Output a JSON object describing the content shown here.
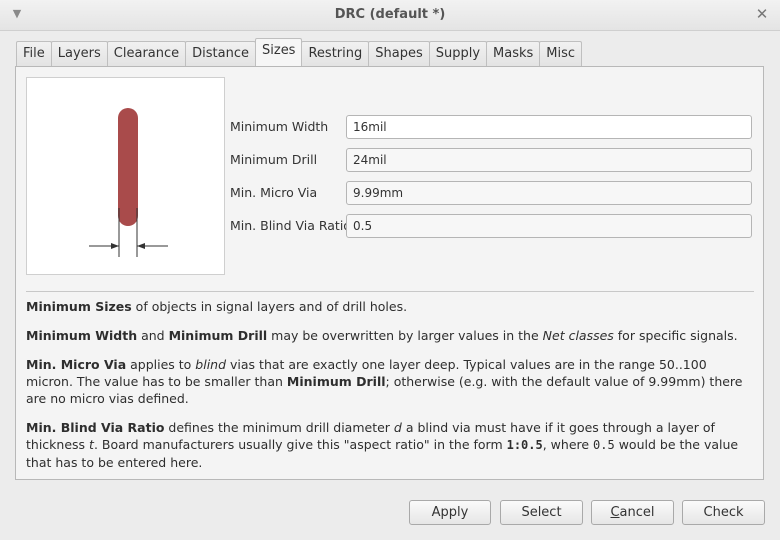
{
  "window": {
    "title": "DRC (default *)"
  },
  "tabs": [
    {
      "label": "File"
    },
    {
      "label": "Layers"
    },
    {
      "label": "Clearance"
    },
    {
      "label": "Distance"
    },
    {
      "label": "Sizes"
    },
    {
      "label": "Restring"
    },
    {
      "label": "Shapes"
    },
    {
      "label": "Supply"
    },
    {
      "label": "Masks"
    },
    {
      "label": "Misc"
    }
  ],
  "active_tab": "Sizes",
  "form": {
    "min_width": {
      "label": "Minimum Width",
      "value": "16mil"
    },
    "min_drill": {
      "label": "Minimum Drill",
      "value": "24mil"
    },
    "micro_via": {
      "label": "Min. Micro Via",
      "value": "9.99mm"
    },
    "blind_ratio": {
      "label": "Min. Blind Via Ratio",
      "value": "0.5"
    }
  },
  "description": {
    "p1": {
      "b1": "Minimum Sizes",
      "t1": " of objects in signal layers and of drill holes."
    },
    "p2": {
      "b1": "Minimum Width",
      "t1": " and ",
      "b2": "Minimum Drill",
      "t2": " may be overwritten by larger values in the ",
      "i1": "Net classes",
      "t3": " for specific signals."
    },
    "p3": {
      "b1": "Min. Micro Via",
      "t1": " applies to ",
      "i1": "blind",
      "t2": " vias that are exactly one layer deep. Typical values are in the range 50..100 micron. The value has to be smaller than ",
      "b2": "Minimum Drill",
      "t3": "; otherwise (e.g. with the default value of 9.99mm) there are no micro vias defined."
    },
    "p4": {
      "b1": "Min. Blind Via Ratio",
      "t1": " defines the minimum drill diameter ",
      "i1": "d",
      "t2": " a blind via must have if it goes through a layer of thickness ",
      "i2": "t",
      "t3": ". Board manufacturers usually give this \"aspect ratio\" in the form ",
      "m1": "1:0.5",
      "t4": ", where ",
      "m2": "0.5",
      "t5": " would be the value that has to be entered here."
    }
  },
  "buttons": {
    "apply": "Apply",
    "select": "Select",
    "cancel_pre": "",
    "cancel_ul": "C",
    "cancel_post": "ancel",
    "check": "Check"
  },
  "colors": {
    "trace": "#a94b4b"
  }
}
